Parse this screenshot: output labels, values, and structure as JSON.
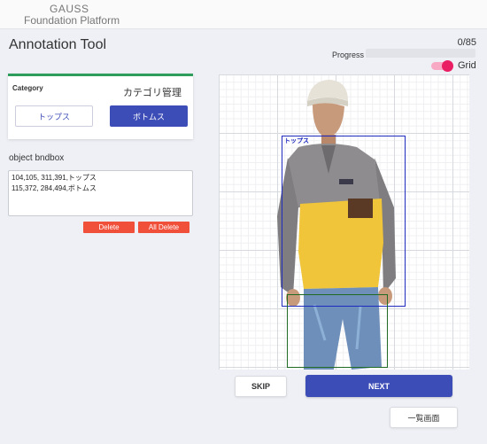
{
  "header": {
    "brand_line1": "GAUSS",
    "brand_line2": "Foundation Platform"
  },
  "page": {
    "title": "Annotation Tool"
  },
  "progress": {
    "count_text": "0/85",
    "label": "Progress :",
    "value": 0,
    "total": 85,
    "fill_fraction": 0,
    "fill_color": "#3d4db7"
  },
  "grid_toggle": {
    "label": "Grid",
    "on": true,
    "color": "#e91e63"
  },
  "category": {
    "label": "Category",
    "management_label": "カテゴリ管理",
    "options": [
      {
        "label": "トップス",
        "selected": false
      },
      {
        "label": "ボトムス",
        "selected": true
      }
    ]
  },
  "bndbox": {
    "title": "object bndbox",
    "lines": [
      "104,105, 311,391,トップス",
      "115,372, 284,494,ボトムス"
    ],
    "delete_label": "Delete",
    "all_delete_label": "All Delete"
  },
  "canvas": {
    "boxes": [
      {
        "label": "トップス",
        "color": "#1f2bbf"
      },
      {
        "label": "",
        "color": "#1f6b24"
      }
    ]
  },
  "actions": {
    "skip_label": "SKIP",
    "next_label": "NEXT",
    "list_label": "一覧画面"
  },
  "colors": {
    "primary": "#3d4db7",
    "danger": "#f04f3a",
    "accent_green": "#2e9d5b",
    "toggle_pink": "#e91e63"
  }
}
